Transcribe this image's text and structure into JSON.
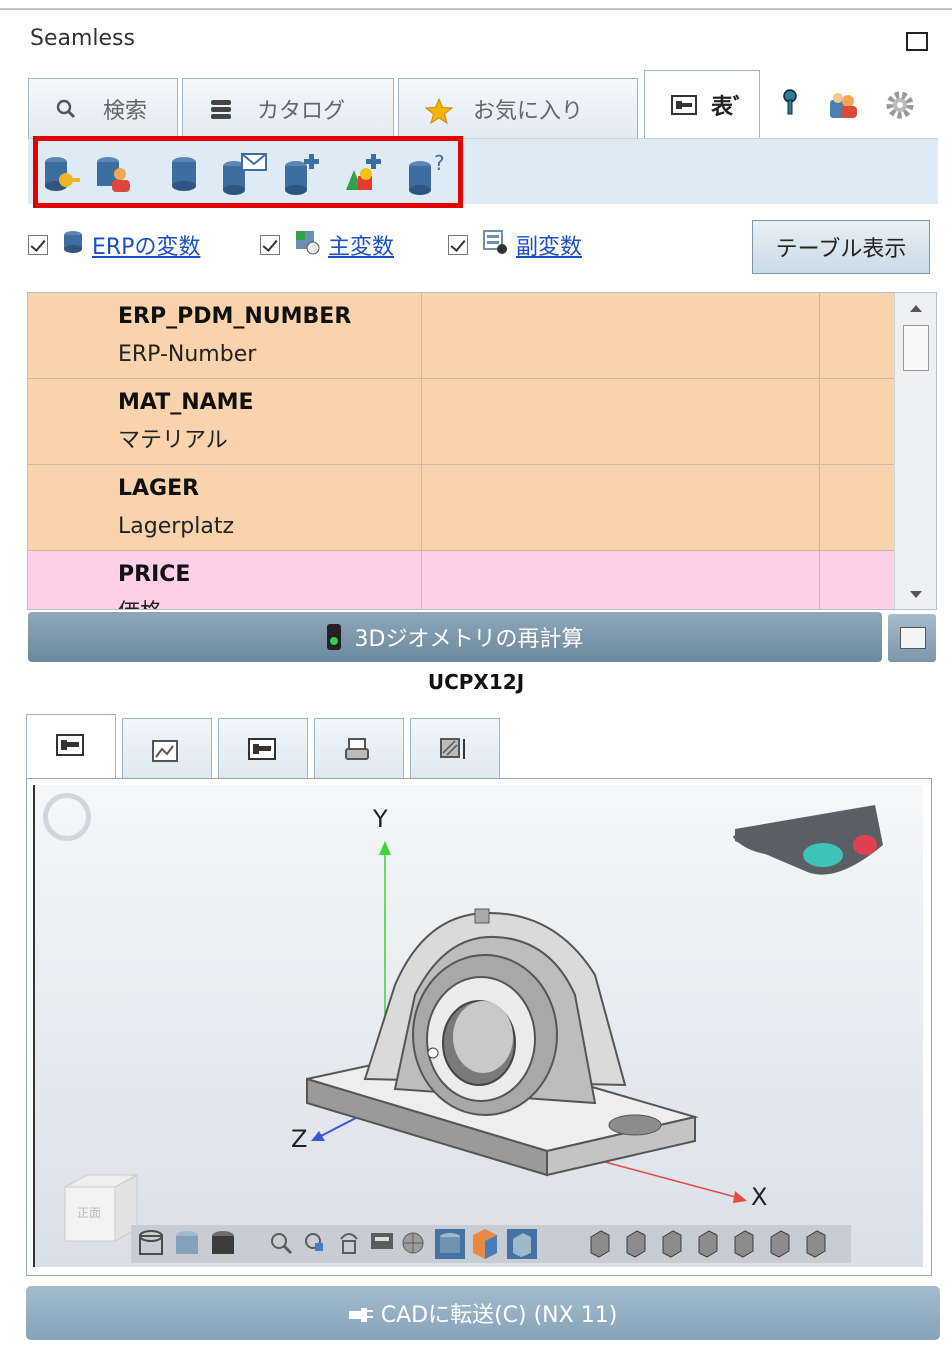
{
  "app": {
    "title": "Seamless"
  },
  "tabs": [
    {
      "label": "検索",
      "icon": "search-icon"
    },
    {
      "label": "カタログ",
      "icon": "catalog-icon"
    },
    {
      "label": "お気に入り",
      "icon": "star-icon"
    },
    {
      "label": "表ﾞ",
      "icon": "view-icon"
    }
  ],
  "toolbar_icons": [
    "db-key-icon",
    "db-users-icon",
    "database-icon",
    "db-mail-icon",
    "db-add-icon",
    "shapes-add-icon",
    "db-help-icon"
  ],
  "variables": {
    "erp": {
      "label": "ERPの変数",
      "checked": true
    },
    "main": {
      "label": "主変数",
      "checked": true
    },
    "sub": {
      "label": "副変数",
      "checked": true
    },
    "table_button": "テーブル表示"
  },
  "rows": [
    {
      "name": "ERP_PDM_NUMBER",
      "label": "ERP-Number",
      "value": "",
      "color": "#fad3ad"
    },
    {
      "name": "MAT_NAME",
      "label": "マテリアル",
      "value": "",
      "color": "#fad3ad"
    },
    {
      "name": "LAGER",
      "label": "Lagerplatz",
      "value": "",
      "color": "#fad3ad"
    },
    {
      "name": "PRICE",
      "label": "価格",
      "value": "",
      "color": "#fdd0e8"
    }
  ],
  "recalc_button": "3Dジオメトリの再計算",
  "part_number": "UCPX12J",
  "viewer_tabs": [
    "view-icon",
    "edit-image-icon",
    "view-icon",
    "print-icon",
    "hatch-dimension-icon"
  ],
  "axes": {
    "x": "X",
    "y": "Y",
    "z": "Z"
  },
  "viewcube_label": "正面",
  "cad_button": "CADに転送(C) (NX 11)",
  "colors": {
    "accent": "#7b93a6",
    "erp_row": "#fad3ad",
    "price_row": "#fdd0e8",
    "highlight": "#e00000"
  }
}
